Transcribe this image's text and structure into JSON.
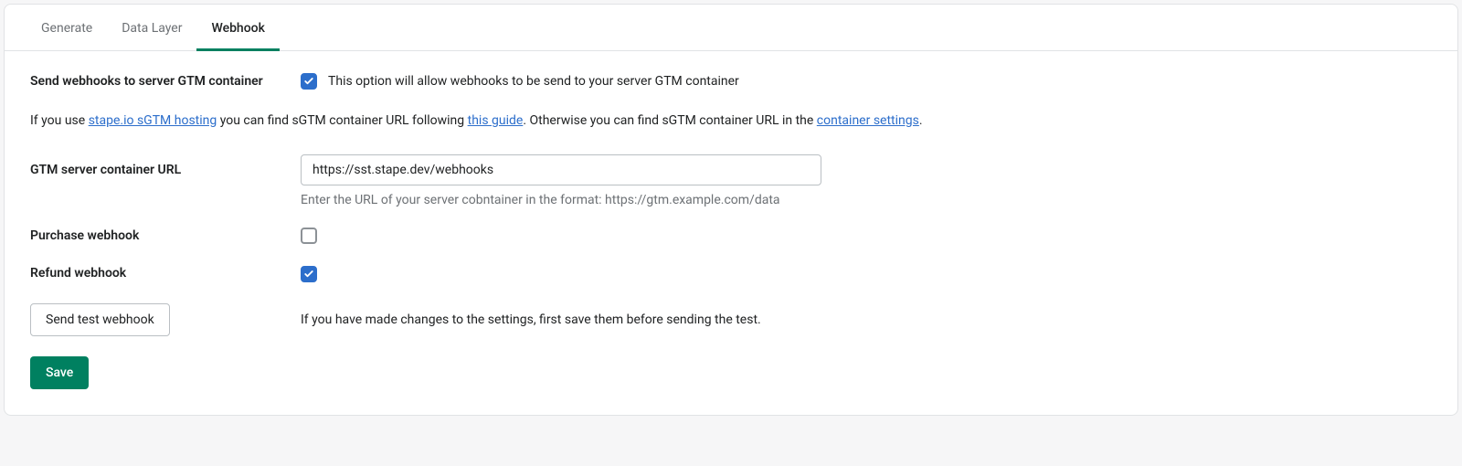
{
  "tabs": {
    "items": [
      {
        "label": "Generate",
        "active": false
      },
      {
        "label": "Data Layer",
        "active": false
      },
      {
        "label": "Webhook",
        "active": true
      }
    ]
  },
  "sendWebhooks": {
    "label": "Send webhooks to server GTM container",
    "checked": true,
    "description": "This option will allow webhooks to be send to your server GTM container"
  },
  "helpText": {
    "part1": "If you use ",
    "link1": "stape.io sGTM hosting",
    "part2": " you can find sGTM container URL following ",
    "link2": "this guide",
    "part3": ". Otherwise you can find sGTM container URL in the ",
    "link3": "container settings",
    "part4": "."
  },
  "containerUrl": {
    "label": "GTM server container URL",
    "value": "https://sst.stape.dev/webhooks",
    "hint": "Enter the URL of your server cobntainer in the format: https://gtm.example.com/data"
  },
  "purchaseWebhook": {
    "label": "Purchase webhook",
    "checked": false
  },
  "refundWebhook": {
    "label": "Refund webhook",
    "checked": true
  },
  "testWebhook": {
    "buttonLabel": "Send test webhook",
    "note": "If you have made changes to the settings, first save them before sending the test."
  },
  "saveButton": {
    "label": "Save"
  }
}
